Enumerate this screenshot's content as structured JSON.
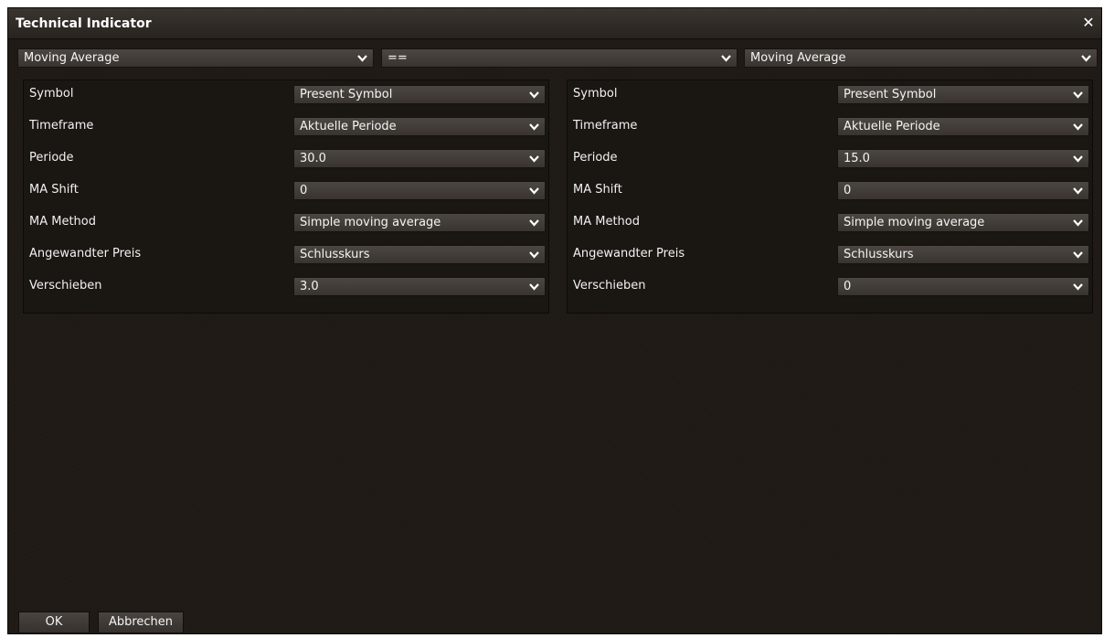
{
  "window": {
    "title": "Technical Indicator"
  },
  "top": {
    "indicator_left": "Moving Average",
    "operator": "==",
    "indicator_right": "Moving Average"
  },
  "left_panel": {
    "rows": [
      {
        "label": "Symbol",
        "value": "Present Symbol"
      },
      {
        "label": "Timeframe",
        "value": "Aktuelle Periode"
      },
      {
        "label": "Periode",
        "value": "30.0"
      },
      {
        "label": "MA Shift",
        "value": "0"
      },
      {
        "label": "MA Method",
        "value": "Simple moving average"
      },
      {
        "label": "Angewandter Preis",
        "value": "Schlusskurs"
      },
      {
        "label": "Verschieben",
        "value": "3.0"
      }
    ]
  },
  "right_panel": {
    "rows": [
      {
        "label": "Symbol",
        "value": "Present Symbol"
      },
      {
        "label": "Timeframe",
        "value": "Aktuelle Periode"
      },
      {
        "label": "Periode",
        "value": "15.0"
      },
      {
        "label": "MA Shift",
        "value": "0"
      },
      {
        "label": "MA Method",
        "value": "Simple moving average"
      },
      {
        "label": "Angewandter Preis",
        "value": "Schlusskurs"
      },
      {
        "label": "Verschieben",
        "value": "0"
      }
    ]
  },
  "buttons": {
    "ok": "OK",
    "cancel": "Abbrechen"
  },
  "icons": {
    "close": "close-icon",
    "dropdown": "chevron-down-icon"
  },
  "colors": {
    "background": "#1e1915",
    "control": "#423c38",
    "text": "#f2f2f2"
  }
}
